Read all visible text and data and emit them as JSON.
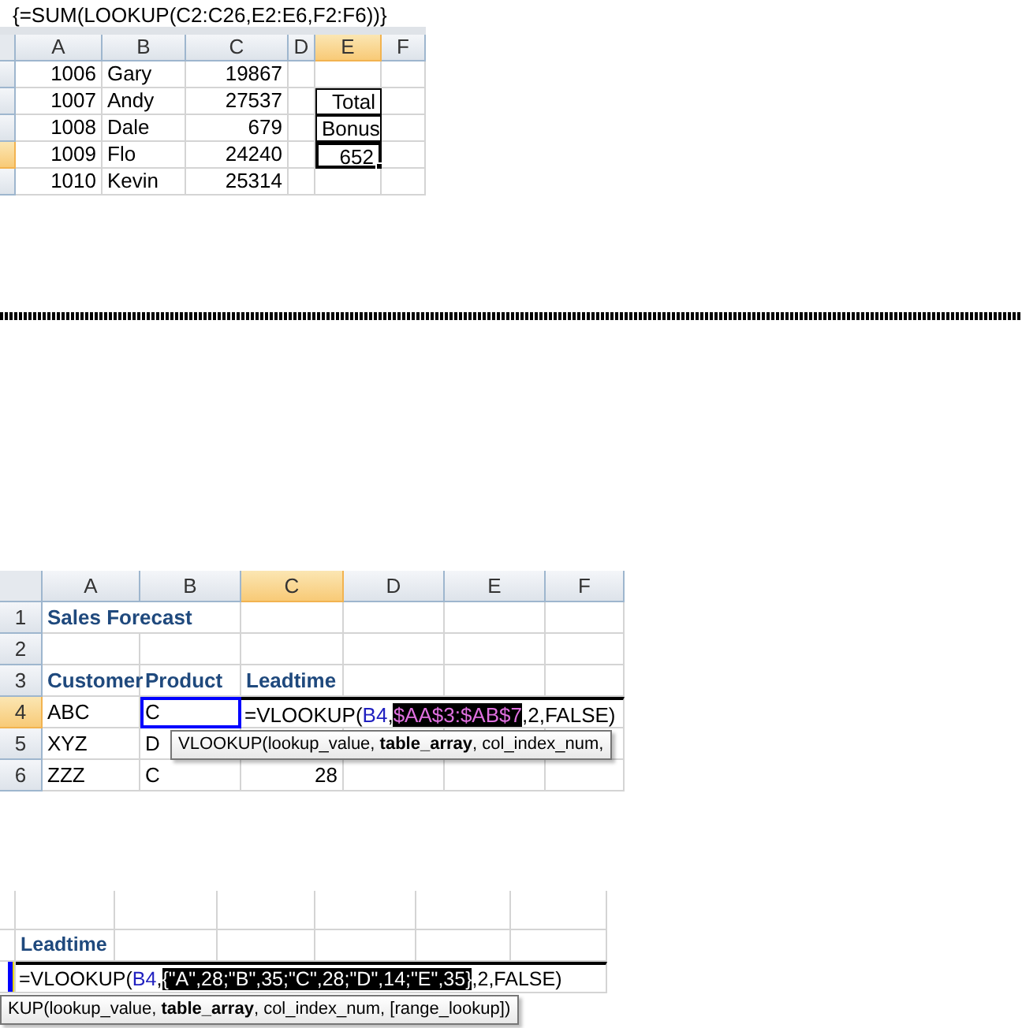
{
  "panels": [
    {
      "formula_bar": "{=SUM(LOOKUP(C2:C26,E2:E6,F2:F6))}",
      "columns": [
        {
          "label": "A",
          "selected": false
        },
        {
          "label": "B",
          "selected": false
        },
        {
          "label": "C",
          "selected": false
        },
        {
          "label": "D",
          "selected": false
        },
        {
          "label": "E",
          "selected": true
        },
        {
          "label": "F",
          "selected": false
        }
      ],
      "rows": [
        {
          "selected": false,
          "cells": [
            {
              "kind": "number",
              "text": "1006"
            },
            {
              "kind": "text",
              "text": "Gary"
            },
            {
              "kind": "number",
              "text": "19867"
            }
          ]
        },
        {
          "selected": false,
          "cells": [
            {
              "kind": "number",
              "text": "1007"
            },
            {
              "kind": "text",
              "text": "Andy"
            },
            {
              "kind": "number",
              "text": "27537"
            },
            {
              "kind": "blank"
            },
            {
              "kind": "number",
              "text": "Total",
              "boxed": true,
              "active": false
            }
          ]
        },
        {
          "selected": false,
          "cells": [
            {
              "kind": "number",
              "text": "1008"
            },
            {
              "kind": "text",
              "text": "Dale"
            },
            {
              "kind": "number",
              "text": "679"
            },
            {
              "kind": "blank"
            },
            {
              "kind": "number",
              "text": "Bonus",
              "boxed": true,
              "active": false
            }
          ]
        },
        {
          "selected": true,
          "cells": [
            {
              "kind": "number",
              "text": "1009"
            },
            {
              "kind": "text",
              "text": "Flo"
            },
            {
              "kind": "number",
              "text": "24240"
            },
            {
              "kind": "blank"
            },
            {
              "kind": "number",
              "text": "652",
              "boxed": true,
              "active": true
            }
          ]
        },
        {
          "selected": false,
          "cells": [
            {
              "kind": "number",
              "text": "1010"
            },
            {
              "kind": "text",
              "text": "Kevin"
            },
            {
              "kind": "number",
              "text": "25314"
            }
          ]
        }
      ]
    },
    {
      "columns": [
        {
          "label": "A",
          "selected": false
        },
        {
          "label": "B",
          "selected": false
        },
        {
          "label": "C",
          "selected": true
        },
        {
          "label": "D",
          "selected": false
        },
        {
          "label": "E",
          "selected": false
        },
        {
          "label": "F",
          "selected": false
        }
      ],
      "rows": [
        {
          "number": "1",
          "selected": false,
          "cells": [
            {
              "kind": "title",
              "text": "Sales Forecast"
            }
          ]
        },
        {
          "number": "2",
          "selected": false,
          "cells": []
        },
        {
          "number": "3",
          "selected": false,
          "cells": [
            {
              "kind": "header",
              "text": "Customer"
            },
            {
              "kind": "header",
              "text": "Product"
            },
            {
              "kind": "header",
              "text": "Leadtime"
            }
          ]
        },
        {
          "number": "4",
          "selected": true,
          "cells": [
            {
              "kind": "text",
              "text": "ABC"
            },
            {
              "kind": "referenced",
              "text": "C"
            },
            {
              "kind": "formula",
              "parts": [
                {
                  "kind": "plain",
                  "text": "=VLOOKUP("
                },
                {
                  "kind": "ref",
                  "text": "B4"
                },
                {
                  "kind": "plain",
                  "text": ","
                },
                {
                  "kind": "range",
                  "text": "$AA$3:$AB$7"
                },
                {
                  "kind": "plain",
                  "text": ",2,FALSE)"
                }
              ]
            }
          ]
        },
        {
          "number": "5",
          "selected": false,
          "cells": [
            {
              "kind": "text",
              "text": "XYZ"
            },
            {
              "kind": "text",
              "text": "D"
            }
          ]
        },
        {
          "number": "6",
          "selected": false,
          "cells": [
            {
              "kind": "text",
              "text": "ZZZ"
            },
            {
              "kind": "text",
              "text": "C"
            },
            {
              "kind": "number",
              "text": "28"
            }
          ]
        }
      ],
      "tooltip": {
        "text": "VLOOKUP(lookup_value, **table_array**, col_index_num,"
      }
    },
    {
      "rows": [
        {
          "cells": []
        },
        {
          "cells": [
            {
              "kind": "blank"
            },
            {
              "kind": "header",
              "text": "Leadtime"
            }
          ]
        },
        {
          "cells": [
            {
              "kind": "referenced"
            },
            {
              "kind": "formula",
              "parts": [
                {
                  "kind": "plain",
                  "text": "=VLOOKUP("
                },
                {
                  "kind": "ref",
                  "text": "B4"
                },
                {
                  "kind": "plain",
                  "text": ","
                },
                {
                  "kind": "array",
                  "text": "{\"A\",28;\"B\",35;\"C\",28;\"D\",14;\"E\",35}"
                },
                {
                  "kind": "plain",
                  "text": ",2,FALSE)"
                }
              ]
            }
          ]
        }
      ],
      "tooltip": {
        "text": "KUP(lookup_value, **table_array**, col_index_num, [range_lookup])"
      }
    }
  ]
}
